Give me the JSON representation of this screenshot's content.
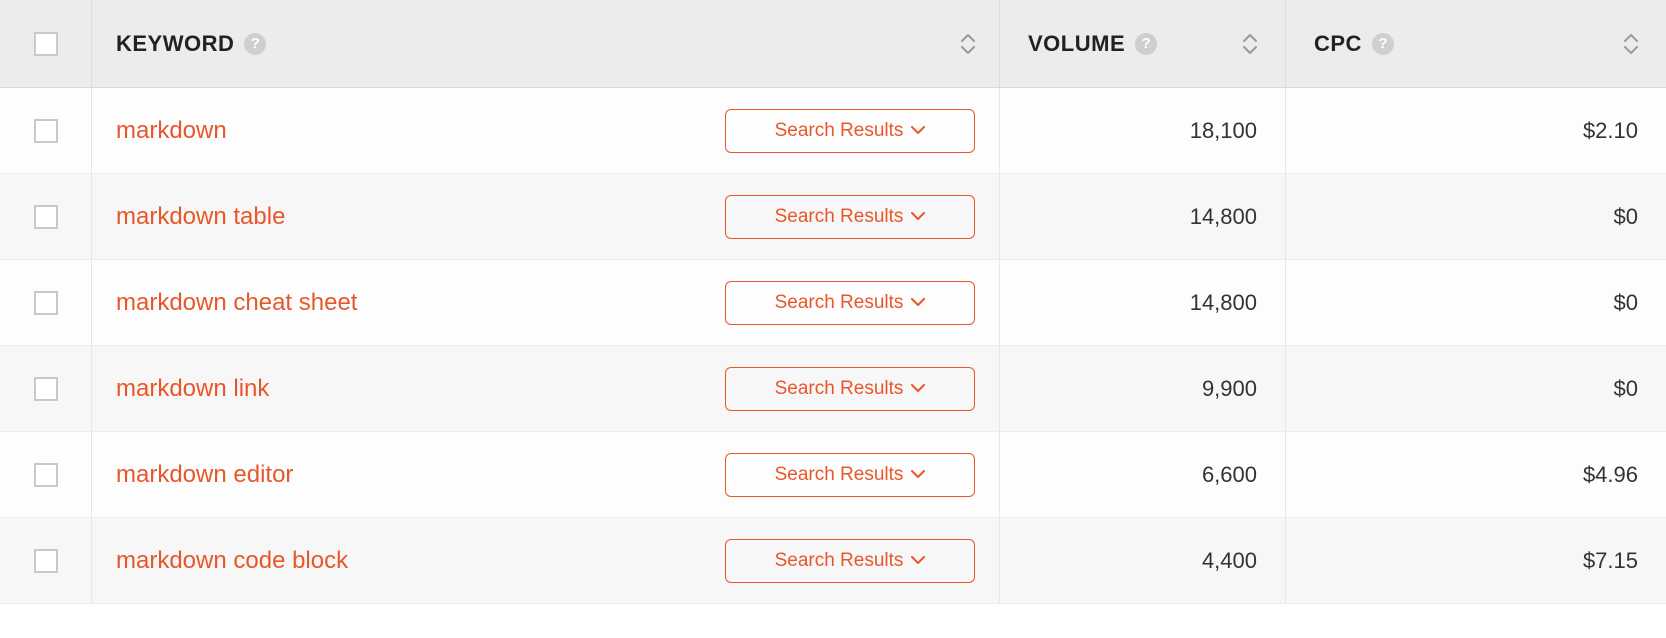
{
  "columns": {
    "keyword_label": "KEYWORD",
    "volume_label": "VOLUME",
    "cpc_label": "CPC"
  },
  "search_results_label": "Search Results",
  "rows": [
    {
      "keyword": "markdown",
      "volume": "18,100",
      "cpc": "$2.10"
    },
    {
      "keyword": "markdown table",
      "volume": "14,800",
      "cpc": "$0"
    },
    {
      "keyword": "markdown cheat sheet",
      "volume": "14,800",
      "cpc": "$0"
    },
    {
      "keyword": "markdown link",
      "volume": "9,900",
      "cpc": "$0"
    },
    {
      "keyword": "markdown editor",
      "volume": "6,600",
      "cpc": "$4.96"
    },
    {
      "keyword": "markdown code block",
      "volume": "4,400",
      "cpc": "$7.15"
    }
  ]
}
